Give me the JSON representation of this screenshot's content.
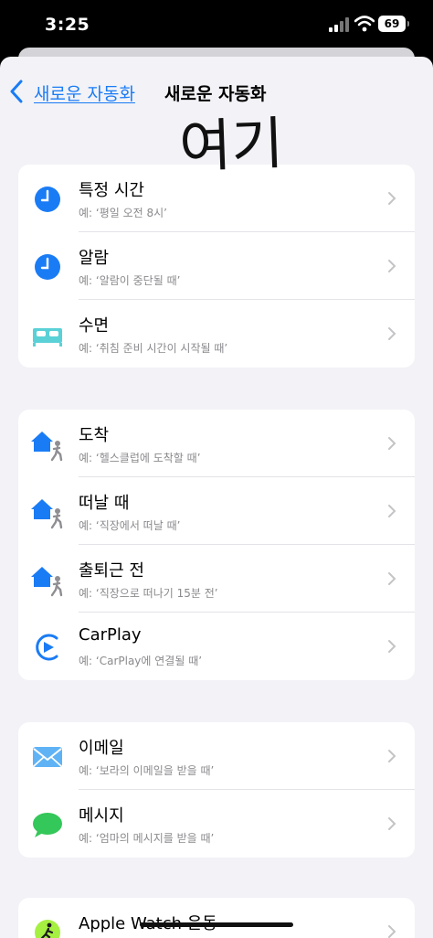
{
  "status_bar": {
    "time": "3:25",
    "battery": "69"
  },
  "nav": {
    "back_label": "새로운 자동화",
    "title": "새로운 자동화"
  },
  "annotation": "여기",
  "groups": [
    {
      "items": [
        {
          "title": "특정 시간",
          "subtitle": "예: ‘평일 오전 8시’",
          "icon": "clock-icon"
        },
        {
          "title": "알람",
          "subtitle": "예: ‘알람이 중단될 때’",
          "icon": "clock-icon"
        },
        {
          "title": "수면",
          "subtitle": "예: ‘취침 준비 시간이 시작될 때’",
          "icon": "bed-icon"
        }
      ]
    },
    {
      "items": [
        {
          "title": "도착",
          "subtitle": "예: ‘헬스클럽에 도착할 때’",
          "icon": "home-person-icon"
        },
        {
          "title": "떠날 때",
          "subtitle": "예: ‘직장에서 떠날 때’",
          "icon": "home-person-icon"
        },
        {
          "title": "출퇴근 전",
          "subtitle": "예: ‘직장으로 떠나기 15분 전’",
          "icon": "home-person-icon"
        },
        {
          "title": "CarPlay",
          "subtitle": "예: ‘CarPlay에 연결될 때’",
          "icon": "carplay-icon"
        }
      ]
    },
    {
      "items": [
        {
          "title": "이메일",
          "subtitle": "예: ‘보라의 이메일을 받을 때’",
          "icon": "mail-icon"
        },
        {
          "title": "메시지",
          "subtitle": "예: ‘엄마의 메시지를 받을 때’",
          "icon": "message-icon"
        }
      ]
    },
    {
      "items": [
        {
          "title": "Apple Watch 운동",
          "subtitle": "",
          "icon": "workout-icon"
        }
      ]
    }
  ],
  "colors": {
    "accent": "#1a7cf5",
    "bed": "#5ad1d6",
    "message": "#34c759",
    "workout": "#a6f041"
  }
}
